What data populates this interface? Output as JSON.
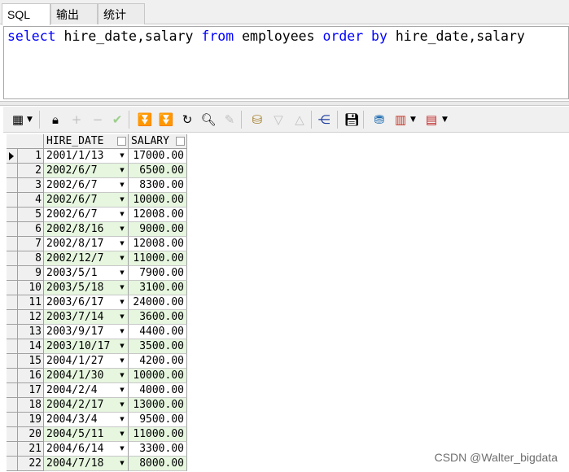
{
  "tabs": [
    {
      "label": "SQL",
      "active": true
    },
    {
      "label": "输出",
      "active": false
    },
    {
      "label": "统计",
      "active": false
    }
  ],
  "editor": {
    "tokens": [
      {
        "text": "select",
        "kind": "kw"
      },
      {
        "text": " hire_date,salary ",
        "kind": "id"
      },
      {
        "text": "from",
        "kind": "kw"
      },
      {
        "text": " employees ",
        "kind": "id"
      },
      {
        "text": "order by",
        "kind": "kw"
      },
      {
        "text": " hire_date,salary",
        "kind": "id"
      }
    ]
  },
  "toolbar": {
    "icons": [
      "grid-view-icon",
      "lock-icon",
      "add-record-icon",
      "delete-record-icon",
      "post-icon",
      "fetch-next-icon",
      "fetch-last-icon",
      "refresh-icon",
      "find-icon",
      "clear-icon",
      "query-by-example-icon",
      "filter-down-icon",
      "filter-up-icon",
      "explain-plan-icon",
      "save-icon",
      "export-icon",
      "chart-icon",
      "table-options-icon"
    ]
  },
  "grid": {
    "columns": [
      "HIRE_DATE",
      "SALARY"
    ],
    "rows": [
      {
        "n": "1",
        "hire_date": "2001/1/13",
        "salary": "17000.00"
      },
      {
        "n": "2",
        "hire_date": "2002/6/7",
        "salary": "6500.00"
      },
      {
        "n": "3",
        "hire_date": "2002/6/7",
        "salary": "8300.00"
      },
      {
        "n": "4",
        "hire_date": "2002/6/7",
        "salary": "10000.00"
      },
      {
        "n": "5",
        "hire_date": "2002/6/7",
        "salary": "12008.00"
      },
      {
        "n": "6",
        "hire_date": "2002/8/16",
        "salary": "9000.00"
      },
      {
        "n": "7",
        "hire_date": "2002/8/17",
        "salary": "12008.00"
      },
      {
        "n": "8",
        "hire_date": "2002/12/7",
        "salary": "11000.00"
      },
      {
        "n": "9",
        "hire_date": "2003/5/1",
        "salary": "7900.00"
      },
      {
        "n": "10",
        "hire_date": "2003/5/18",
        "salary": "3100.00"
      },
      {
        "n": "11",
        "hire_date": "2003/6/17",
        "salary": "24000.00"
      },
      {
        "n": "12",
        "hire_date": "2003/7/14",
        "salary": "3600.00"
      },
      {
        "n": "13",
        "hire_date": "2003/9/17",
        "salary": "4400.00"
      },
      {
        "n": "14",
        "hire_date": "2003/10/17",
        "salary": "3500.00"
      },
      {
        "n": "15",
        "hire_date": "2004/1/27",
        "salary": "4200.00"
      },
      {
        "n": "16",
        "hire_date": "2004/1/30",
        "salary": "10000.00"
      },
      {
        "n": "17",
        "hire_date": "2004/2/4",
        "salary": "4000.00"
      },
      {
        "n": "18",
        "hire_date": "2004/2/17",
        "salary": "13000.00"
      },
      {
        "n": "19",
        "hire_date": "2004/3/4",
        "salary": "9500.00"
      },
      {
        "n": "20",
        "hire_date": "2004/5/11",
        "salary": "11000.00"
      },
      {
        "n": "21",
        "hire_date": "2004/6/14",
        "salary": "3300.00"
      },
      {
        "n": "22",
        "hire_date": "2004/7/18",
        "salary": "8000.00"
      }
    ]
  },
  "watermark": "CSDN @Walter_bigdata",
  "colors": {
    "keyword": "#0000ff",
    "alt_row": "#e6f6df"
  }
}
